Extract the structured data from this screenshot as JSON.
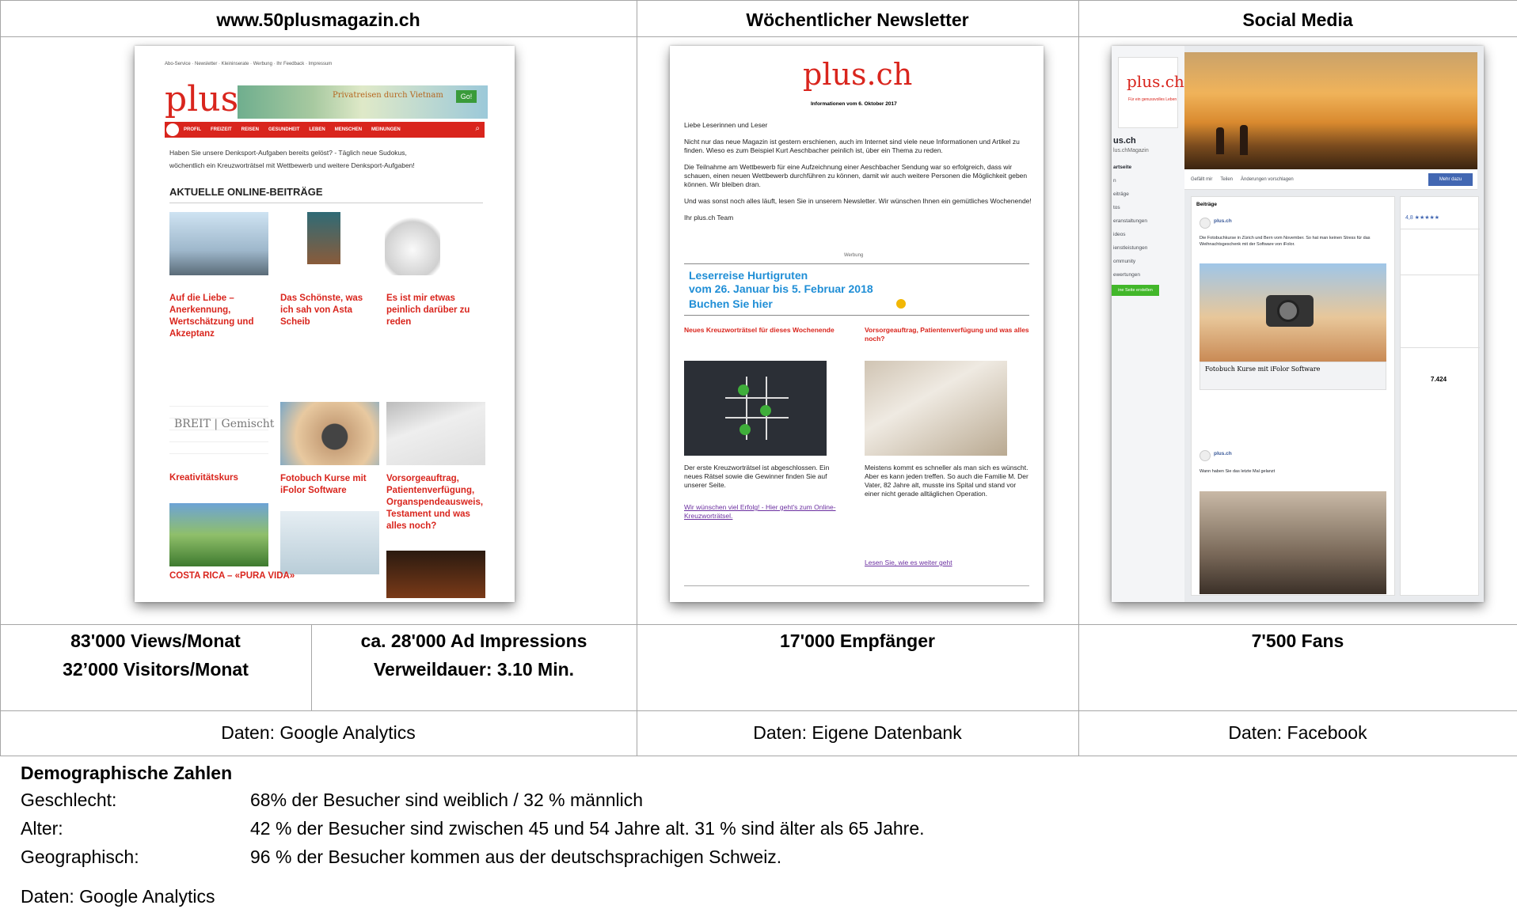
{
  "columns": [
    {
      "header": "www.50plusmagazin.ch"
    },
    {
      "header": "Wöchentlicher Newsletter"
    },
    {
      "header": "Social Media"
    }
  ],
  "stats": {
    "web_views": "83'000 Views/Monat",
    "web_visitors": "32’000 Visitors/Monat",
    "web_ads": "ca. 28'000 Ad Impressions",
    "web_time": "Verweildauer: 3.10 Min.",
    "newsletter": "17'000 Empfänger",
    "social": "7'500 Fans"
  },
  "sources": {
    "web": "Daten: Google Analytics",
    "newsletter": "Daten: Eigene Datenbank",
    "social": "Daten: Facebook"
  },
  "web_shot": {
    "topnav": "Abo-Service · Newsletter · Kleininserate · Werbung · Ihr Feedback · Impressum",
    "logo": "plus.c",
    "ad_title": "Privatreisen durch Vietnam",
    "ad_go": "Go!",
    "menu": [
      "PROFIL",
      "FREIZEIT",
      "REISEN",
      "GESUNDHEIT",
      "LEBEN",
      "MENSCHEN",
      "MEINUNGEN"
    ],
    "intro1": "Haben Sie unsere Denksport-Aufgaben bereits gelöst? - Täglich neue Sudokus,",
    "intro2": "wöchentlich ein Kreuzworträtsel mit Wettbewerb und weitere Denksport-Aufgaben!",
    "section": "AKTUELLE ONLINE-BEITRÄGE",
    "articles": [
      "Auf die Liebe – Anerkennung, Wertschätzung und Akzeptanz",
      "Das Schönste, was ich sah von Asta Scheib",
      "Es ist mir etwas peinlich darüber zu reden",
      "Kreativitätskurs",
      "Fotobuch Kurse mit iFolor Software",
      "Vorsorgeauftrag, Patientenverfügung, Organspendeausweis, Testament und was alles noch?",
      "COSTA RICA – «PURA VIDA»"
    ]
  },
  "news_shot": {
    "logo": "plus.ch",
    "date": "Informationen vom 6. Oktober 2017",
    "greeting": "Liebe Leserinnen und Leser",
    "p1": "Nicht nur das neue Magazin ist gestern erschienen, auch im Internet sind viele neue Informationen und Artikel zu finden. Wieso es zum Beispiel Kurt Aeschbacher peinlich ist, über ein Thema zu reden.",
    "p2": "Die Teilnahme am Wettbewerb für eine Aufzeichnung einer Aeschbacher Sendung war so erfolgreich, dass wir schauen, einen neuen Wettbewerb durchführen zu können, damit wir auch weitere Personen die Möglichkeit geben können. Wir bleiben dran.",
    "p3": "Und was sonst noch alles läuft, lesen Sie in unserem Newsletter. Wir wünschen Ihnen ein gemütliches Wochenende!",
    "team": "Ihr plus.ch Team",
    "werbung": "Werbung",
    "banner1": "Leserreise Hurtigruten",
    "banner2": "vom 26. Januar bis 5. Februar 2018",
    "banner3": "Buchen Sie hier",
    "left_title": "Neues Kreuzworträtsel für dieses Wochenende",
    "right_title": "Vorsorgeauftrag, Patientenverfügung und was alles noch?",
    "left_text": "Der erste Kreuzworträtsel ist abgeschlossen. Ein neues Rätsel sowie die Gewinner finden Sie auf unserer Seite.",
    "left_wish": "Wir wünschen viel Erfolg! - Hier geht's zum Online-Kreuzworträtsel.",
    "right_text": "Meistens kommt es schneller als man sich es wünscht. Aber es kann jeden treffen. So auch die Familie M. Der Vater, 82 Jahre alt, musste ins Spital und stand vor einer nicht gerade alltäglichen Operation.",
    "right_link": "Lesen Sie, wie es weiter geht"
  },
  "fb_shot": {
    "logo": "plus.ch",
    "tagline": "Für ein genussvolles Leben",
    "page_name": "us.ch",
    "page_handle": "lus.chMagazin",
    "nav": [
      "artseite",
      "n",
      "eiträge",
      "tos",
      "eranstaltungen",
      "ideos",
      "ienstleistungen",
      "ommunity",
      "ewertungen"
    ],
    "create_btn": "ine Seite erstellen",
    "actions": [
      "Gefällt mir",
      "Teilen",
      "Änderungen vorschlagen"
    ],
    "more_btn": "Mehr dazu",
    "posts_label": "Beiträge",
    "post_author": "plus.ch",
    "post_text": "Die Fotobuchkurse in Zürich und Bern vom November. So hat man keinen Stress für das Weihnachtsgeschenk mit der Software von iFolor.",
    "post_caption": "Fotobuch Kurse mit iFolor Software",
    "post2_text": "Wann haben Sie das letzte Mal gelanzt",
    "side_rating": "4,8 ★★★★★",
    "side_fans": "7.424"
  },
  "demographics": {
    "title": "Demographische Zahlen",
    "rows": [
      {
        "label": "Geschlecht:",
        "value": "68% der Besucher sind weiblich / 32 % männlich"
      },
      {
        "label": "Alter:",
        "value": "42 % der Besucher sind zwischen 45 und 54 Jahre alt. 31 % sind älter als 65 Jahre."
      },
      {
        "label": "Geographisch:",
        "value": "96 % der Besucher kommen aus der deutschsprachigen Schweiz."
      }
    ],
    "source": "Daten: Google Analytics"
  },
  "colors": {
    "accent_red": "#d9251d",
    "fb_blue": "#4267b2",
    "banner_blue": "#1f8ed6"
  }
}
